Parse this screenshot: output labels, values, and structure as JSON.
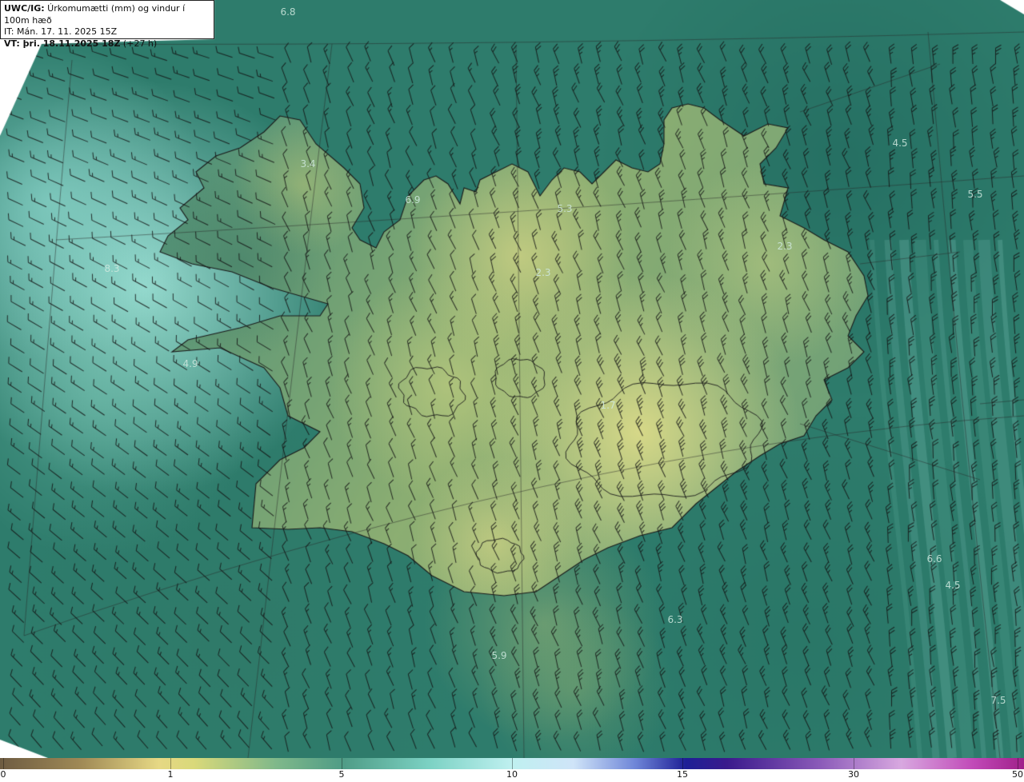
{
  "header": {
    "line1_bold": "UWC/IG:",
    "line1_text": " Úrkomumætti (mm) og vindur í 100m hæð",
    "line2": "IT: Mán. 17. 11. 2025 15Z",
    "line3_bold": "VT: þri. 18.11.2025 18Z",
    "line3_text": " (+27 h)"
  },
  "labels": [
    {
      "text": "6.8"
    },
    {
      "text": "3.4"
    },
    {
      "text": "6.9"
    },
    {
      "text": "5.3"
    },
    {
      "text": "4.5"
    },
    {
      "text": "5.5"
    },
    {
      "text": "2.3"
    },
    {
      "text": "2.3"
    },
    {
      "text": "8.3"
    },
    {
      "text": "4.9"
    },
    {
      "text": "1.7"
    },
    {
      "text": "6.6"
    },
    {
      "text": "4.5"
    },
    {
      "text": "6.3"
    },
    {
      "text": "5.9"
    },
    {
      "text": "7.5"
    }
  ],
  "colorbar": {
    "ticks": [
      "0",
      "1",
      "5",
      "10",
      "15",
      "30",
      "50"
    ]
  },
  "colors": {
    "coast": "#1a1a1a",
    "land_high": "#e6df8c",
    "sea": "#2f7f6e",
    "sea_light": "#8fd9d2"
  }
}
